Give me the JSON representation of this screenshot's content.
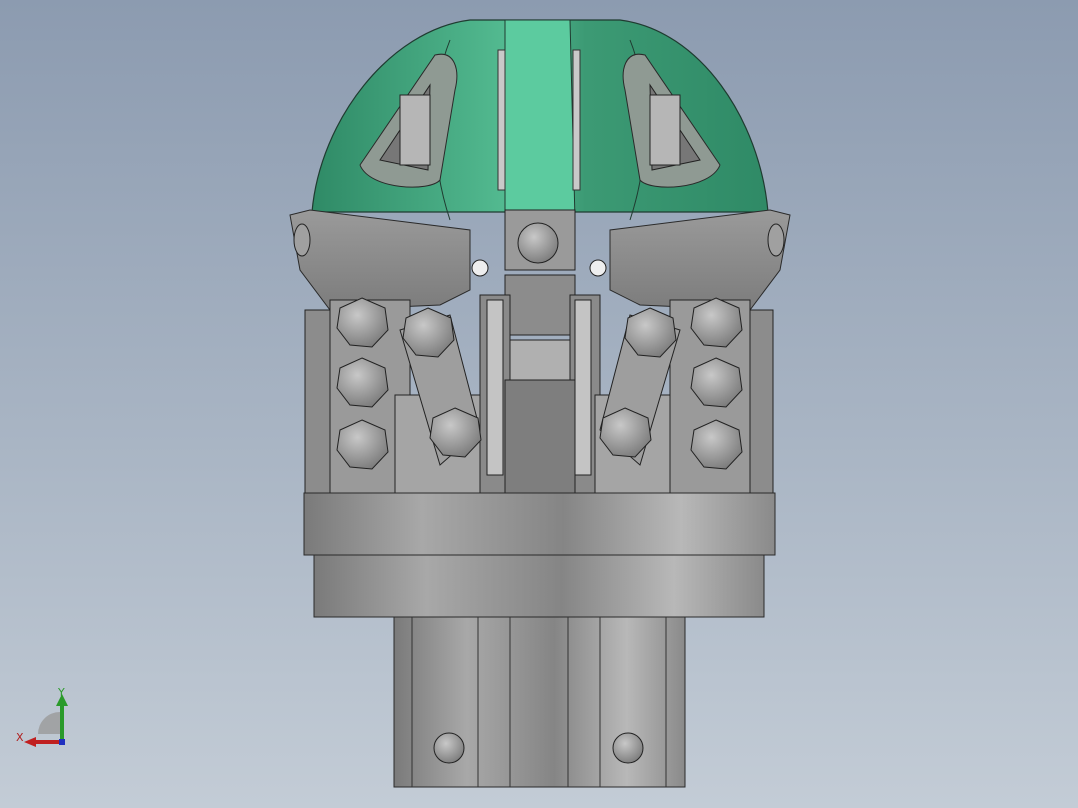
{
  "viewport": {
    "background_top": "#8c9bb0",
    "background_bottom": "#c3ccd6"
  },
  "model": {
    "description_colors": {
      "dome_green": "#3f9c78",
      "dome_light": "#5cc79d",
      "metal_gray": "#8e8e8e",
      "metal_light": "#b4b4b4",
      "outline": "#2a2a2a"
    }
  },
  "triad": {
    "y_label": "Y",
    "x_label": "X",
    "y_color": "#2a9a2a",
    "x_color": "#c02020"
  }
}
